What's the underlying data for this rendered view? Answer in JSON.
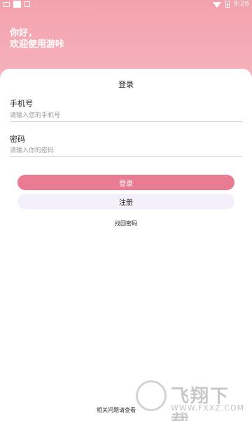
{
  "status_bar": {
    "time": "9:26"
  },
  "header": {
    "greeting_line1": "你好，",
    "greeting_line2": "欢迎使用游咔"
  },
  "login_card": {
    "title": "登录",
    "phone": {
      "label": "手机号",
      "placeholder": "请输入您的手机号",
      "value": ""
    },
    "password": {
      "label": "密码",
      "placeholder": "请输入你的密码",
      "value": ""
    },
    "login_button": "登录",
    "register_button": "注册",
    "forgot_password": "找回密码"
  },
  "footer": {
    "text": "相关问题请查看"
  },
  "watermark": {
    "brand": "飞翔下载",
    "url": "WWW.FXXZ.COM"
  },
  "colors": {
    "header_gradient_top": "#f3a2ad",
    "header_gradient_bottom": "#f6b3bd",
    "primary_button": "#e97b93",
    "secondary_button": "#f3f0fb"
  }
}
